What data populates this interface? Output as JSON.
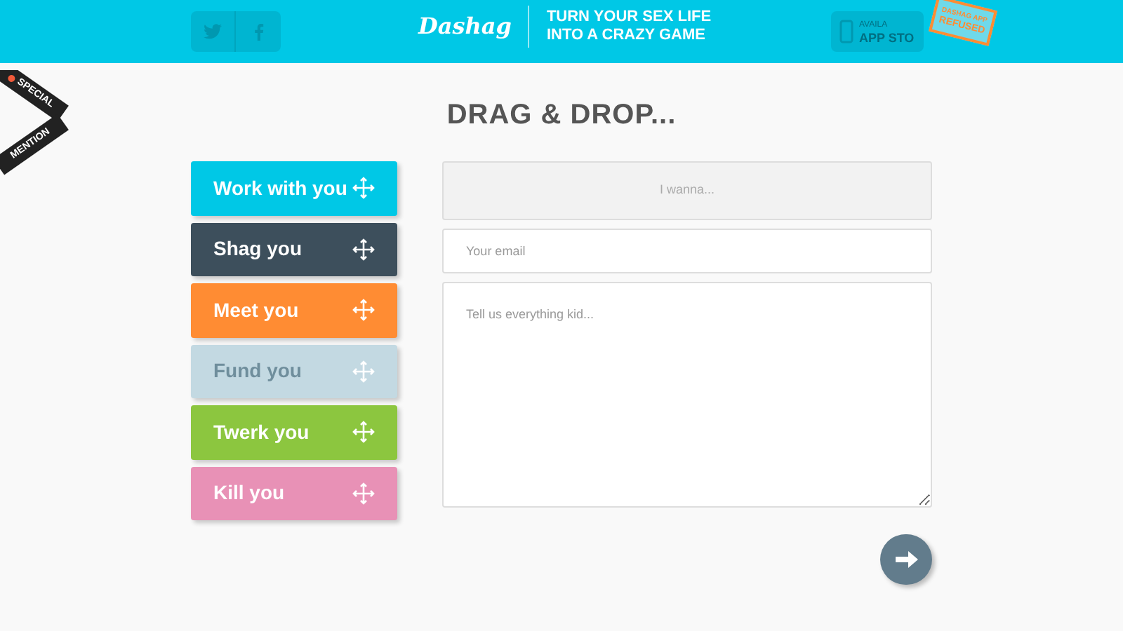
{
  "header": {
    "logo": "Dashag",
    "tagline": [
      "TURN YOUR SEX LIFE",
      "INTO A CRAZY GAME"
    ],
    "store_button": [
      "AVAILA",
      "APP STO"
    ],
    "stamp": [
      "DASHAG APP",
      "REFUSED"
    ]
  },
  "ribbon": [
    "SPECIAL",
    "MENTION"
  ],
  "title": "DRAG & DROP...",
  "options": [
    {
      "label": "Work with you",
      "color": "#00c8e6",
      "disabled": false
    },
    {
      "label": "Shag you",
      "color": "#3d4f5c",
      "disabled": false
    },
    {
      "label": "Meet you",
      "color": "#ff8c33",
      "disabled": false
    },
    {
      "label": "Fund you",
      "color": "#c3d9e2",
      "disabled": true
    },
    {
      "label": "Twerk you",
      "color": "#8cc63f",
      "disabled": false
    },
    {
      "label": "Kill you",
      "color": "#e891b6",
      "disabled": false
    }
  ],
  "form": {
    "drop_zone": "I wanna...",
    "email": {
      "placeholder": "Your email"
    },
    "message": {
      "placeholder": "Tell us everything kid..."
    }
  }
}
